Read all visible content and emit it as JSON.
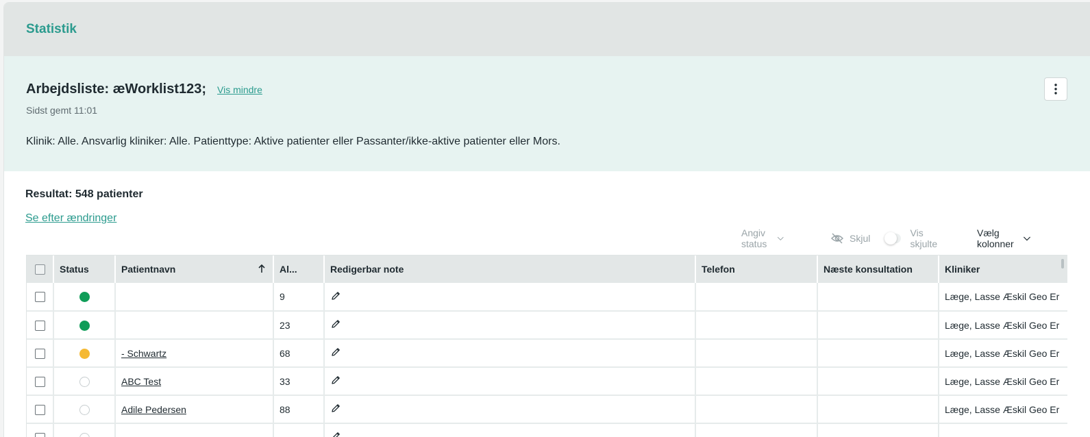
{
  "header": {
    "title": "Statistik"
  },
  "worklist": {
    "title": "Arbejdsliste: æWorklist123;",
    "toggle_label": "Vis mindre",
    "saved": "Sidst gemt 11:01",
    "criteria": "Klinik: Alle. Ansvarlig kliniker: Alle. Patienttype: Aktive patienter eller Passanter/ikke-aktive patienter eller Mors."
  },
  "result": {
    "label": "Resultat: 548 patienter",
    "changes_link": "Se efter ændringer"
  },
  "toolbar": {
    "status_label": "Angiv status",
    "hide_label": "Skjul",
    "show_hidden_label": "Vis skjulte",
    "choose_columns_label": "Vælg kolonner"
  },
  "table": {
    "columns": {
      "status": "Status",
      "patient": "Patientnavn",
      "age": "Al...",
      "note": "Redigerbar note",
      "phone": "Telefon",
      "next": "Næste konsultation",
      "clinician": "Kliniker"
    },
    "rows": [
      {
        "status": "green",
        "name": "",
        "age": "9",
        "phone": "",
        "next": "",
        "clinician": "Læge, Lasse Æskil Geo Er"
      },
      {
        "status": "green",
        "name": "",
        "age": "23",
        "phone": "",
        "next": "",
        "clinician": "Læge, Lasse Æskil Geo Er"
      },
      {
        "status": "yellow",
        "name": "- Schwartz",
        "age": "68",
        "phone": "",
        "next": "",
        "clinician": "Læge, Lasse Æskil Geo Er"
      },
      {
        "status": "none",
        "name": "ABC Test",
        "age": "33",
        "phone": "",
        "next": "",
        "clinician": "Læge, Lasse Æskil Geo Er"
      },
      {
        "status": "none",
        "name": "Adile Pedersen",
        "age": "88",
        "phone": "",
        "next": "",
        "clinician": "Læge, Lasse Æskil Geo Er"
      },
      {
        "status": "none",
        "name": "",
        "age": "",
        "phone": "",
        "next": "",
        "clinician": ""
      }
    ]
  },
  "colors": {
    "accent": "#2b9b8e",
    "status_green": "#0f9d58",
    "status_yellow": "#f5b933"
  }
}
